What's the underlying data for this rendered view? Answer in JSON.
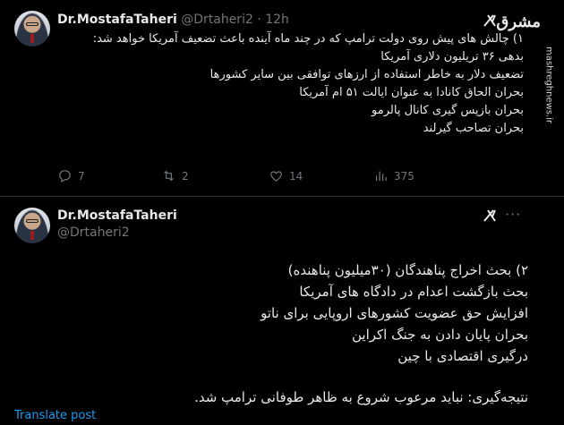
{
  "tweet1": {
    "display_name": "Dr.MostafaTaheri",
    "handle": "@Drtaheri2",
    "separator": "·",
    "time": "12h",
    "lines": [
      "۱) چالش های پیش روی دولت ترامپ که در چند ماه آینده باعث تضعیف آمریکا خواهد شد:",
      "بدهی ۳۶ تریلیون دلاری آمریکا",
      "تضعیف دلار به خاطر استفاده از ارزهای توافقی بین سایر کشورها",
      "بحران الحاق کانادا به عنوان ایالت ۵۱ ام آمریکا",
      "بحران بازپس گیری کانال پالرمو",
      "بحران تصاحب گیرلند"
    ],
    "replies": "7",
    "retweets": "2",
    "likes": "14",
    "views": "375"
  },
  "watermark": {
    "logo": "مشرق",
    "url": "mashreghnews.ir"
  },
  "tweet2": {
    "display_name": "Dr.MostafaTaheri",
    "handle": "@Drtaheri2",
    "more": "···",
    "lines": [
      "۲) بحث اخراج پناهندگان (۳۰میلیون پناهنده)",
      "بحث بازگشت اعدام در دادگاه های آمریکا",
      "افزایش حق عضویت کشورهای اروپایی برای ناتو",
      "بحران پایان دادن به جنگ اکراین",
      "درگیری اقتصادی با چین"
    ],
    "conclusion": "نتیجه‌گیری: نباید مرعوب شروع به ظاهر طوفانی ترامپ شد.",
    "translate": "Translate post"
  },
  "icons": {
    "reply": "reply-icon",
    "retweet": "retweet-icon",
    "like": "heart-icon",
    "views": "views-icon",
    "grok": "grok-icon"
  }
}
